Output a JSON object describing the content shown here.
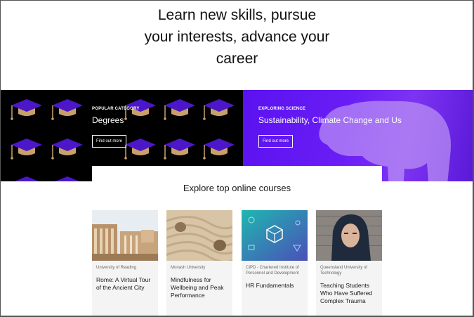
{
  "hero": {
    "heading_line1": "Learn new skills, pursue",
    "heading_line2": "your interests, advance your",
    "heading_line3": "career"
  },
  "banners": [
    {
      "eyebrow": "POPULAR CATEGORY",
      "title": "Degrees",
      "button": "Find out more",
      "background": "#000000",
      "icon": "graduation-cap-pattern"
    },
    {
      "eyebrow": "EXPLORING SCIENCE",
      "title": "Sustainability, Climate Change and Us",
      "button": "Find out more",
      "background": "#6a1ef5",
      "icon": "polar-bear"
    }
  ],
  "courses_section": {
    "title": "Explore top online courses",
    "courses": [
      {
        "org": "University of Reading",
        "title": "Rome: A Virtual Tour of the Ancient City",
        "image": "roman-ruins"
      },
      {
        "org": "Monash University",
        "title": "Mindfulness for Wellbeing and Peak Performance",
        "image": "zen-sand-stones"
      },
      {
        "org": "CIPD - Chartered Institute of Personnel and Development",
        "title": "HR Fundamentals",
        "image": "teal-icon-pattern"
      },
      {
        "org": "Queensland University of Technology",
        "title": "Teaching Students Who Have Suffered Complex Trauma",
        "image": "hooded-student"
      }
    ]
  },
  "colors": {
    "accent_purple": "#6a1ef5",
    "cap_purple": "#4b17c9",
    "tassel_gold": "#c9a06a"
  }
}
